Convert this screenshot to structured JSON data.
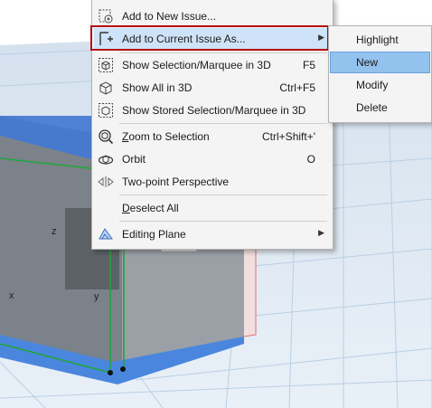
{
  "context_menu": {
    "items": [
      {
        "label": "Add to New Issue...",
        "shortcut": "",
        "icon": "add-to-new-issue-icon"
      },
      {
        "label": "Add to Current Issue As...",
        "shortcut": "",
        "icon": "add-to-current-issue-icon",
        "submenu": true
      },
      {
        "label": "Show Selection/Marquee in 3D",
        "shortcut": "F5",
        "icon": "show-selection-3d-icon"
      },
      {
        "label": "Show All in 3D",
        "shortcut": "Ctrl+F5",
        "icon": "show-all-3d-icon"
      },
      {
        "label": "Show Stored Selection/Marquee in 3D",
        "shortcut": "",
        "icon": "show-stored-selection-icon"
      },
      {
        "label": "Zoom to Selection",
        "shortcut": "Ctrl+Shift+'",
        "icon": "zoom-to-selection-icon"
      },
      {
        "label": "Orbit",
        "shortcut": "O",
        "icon": "orbit-icon"
      },
      {
        "label": "Two-point Perspective",
        "shortcut": "",
        "icon": "two-point-perspective-icon"
      },
      {
        "label": "Deselect All",
        "shortcut": "",
        "icon": ""
      },
      {
        "label": "Editing Plane",
        "shortcut": "",
        "icon": "editing-plane-icon",
        "submenu": true
      }
    ]
  },
  "submenu": {
    "items": [
      "Highlight",
      "New",
      "Modify",
      "Delete"
    ],
    "selected": "New"
  },
  "viewport": {
    "axis_labels": {
      "x": "x",
      "y": "y",
      "z": "z"
    }
  },
  "colors": {
    "accent_highlight": "#b40f16",
    "selected_item": "#94c2ee",
    "hover_item": "#cfe3f8",
    "selection_blue": "#3a78d6",
    "grid": "#b8d0e6"
  }
}
